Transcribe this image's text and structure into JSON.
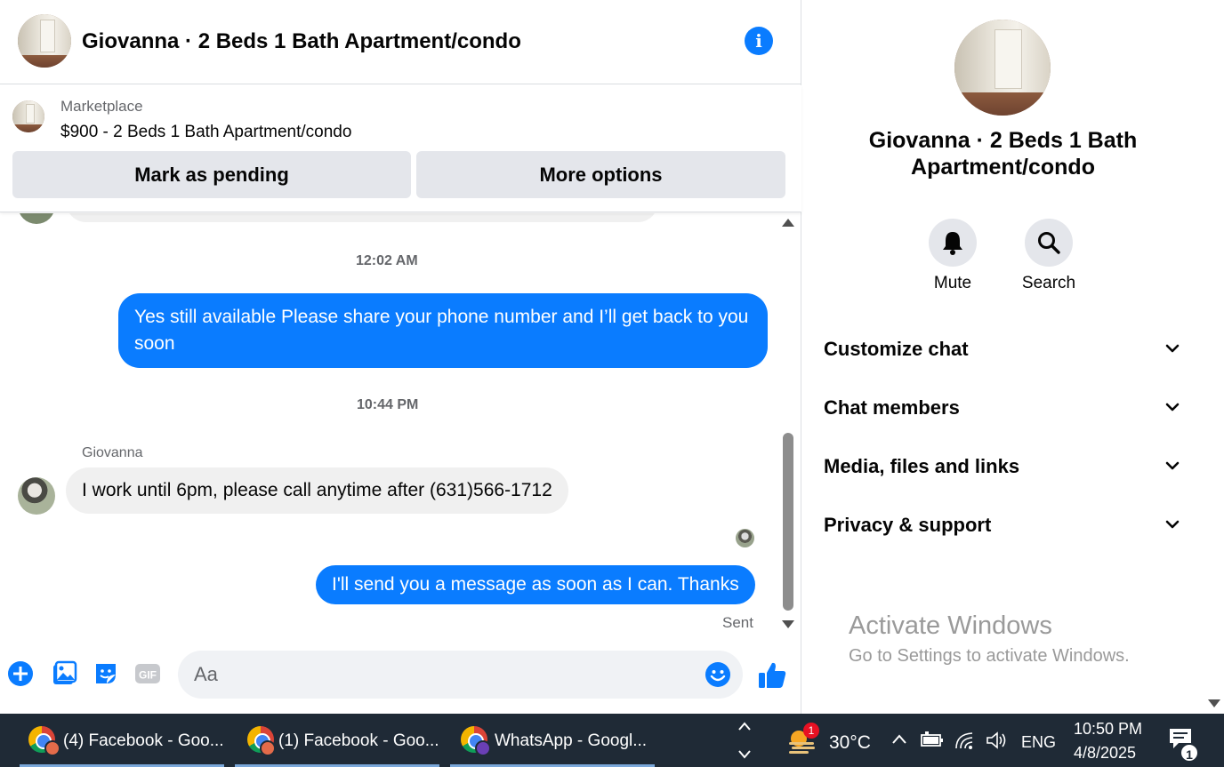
{
  "header": {
    "title": "Giovanna · 2 Beds 1 Bath Apartment/condo"
  },
  "marketplace": {
    "label": "Marketplace",
    "item": "$900 - 2 Beds 1 Bath Apartment/condo",
    "mark_pending": "Mark as pending",
    "more_options": "More options"
  },
  "messages": {
    "time1": "12:02 AM",
    "out1": "Yes still available Please share your phone number and I’ll get back to you soon",
    "time2": "10:44 PM",
    "sender": "Giovanna",
    "in1": "I work until 6pm, please call anytime after (631)566-1712",
    "out2": "I'll send you a message as soon as I can. Thanks",
    "status": "Sent"
  },
  "composer": {
    "placeholder": "Aa",
    "gif_label": "GIF"
  },
  "details": {
    "title": "Giovanna · 2 Beds 1 Bath Apartment/condo",
    "mute": "Mute",
    "search": "Search",
    "sections": [
      {
        "label": "Customize chat"
      },
      {
        "label": "Chat members"
      },
      {
        "label": "Media, files and links"
      },
      {
        "label": "Privacy & support"
      }
    ]
  },
  "watermark": {
    "line1": "Activate Windows",
    "line2": "Go to Settings to activate Windows."
  },
  "taskbar": {
    "tasks": [
      {
        "label": "(4) Facebook - Goo..."
      },
      {
        "label": "(1) Facebook - Goo..."
      },
      {
        "label": "WhatsApp - Googl..."
      }
    ],
    "weather_badge": "1",
    "temperature": "30°C",
    "language": "ENG",
    "time": "10:50 PM",
    "date": "4/8/2025",
    "notifications": "1"
  },
  "colors": {
    "accent": "#0a7cff",
    "bubble_in": "#f0f0f0",
    "button_bg": "#e4e6eb",
    "taskbar": "#1f2a36"
  }
}
